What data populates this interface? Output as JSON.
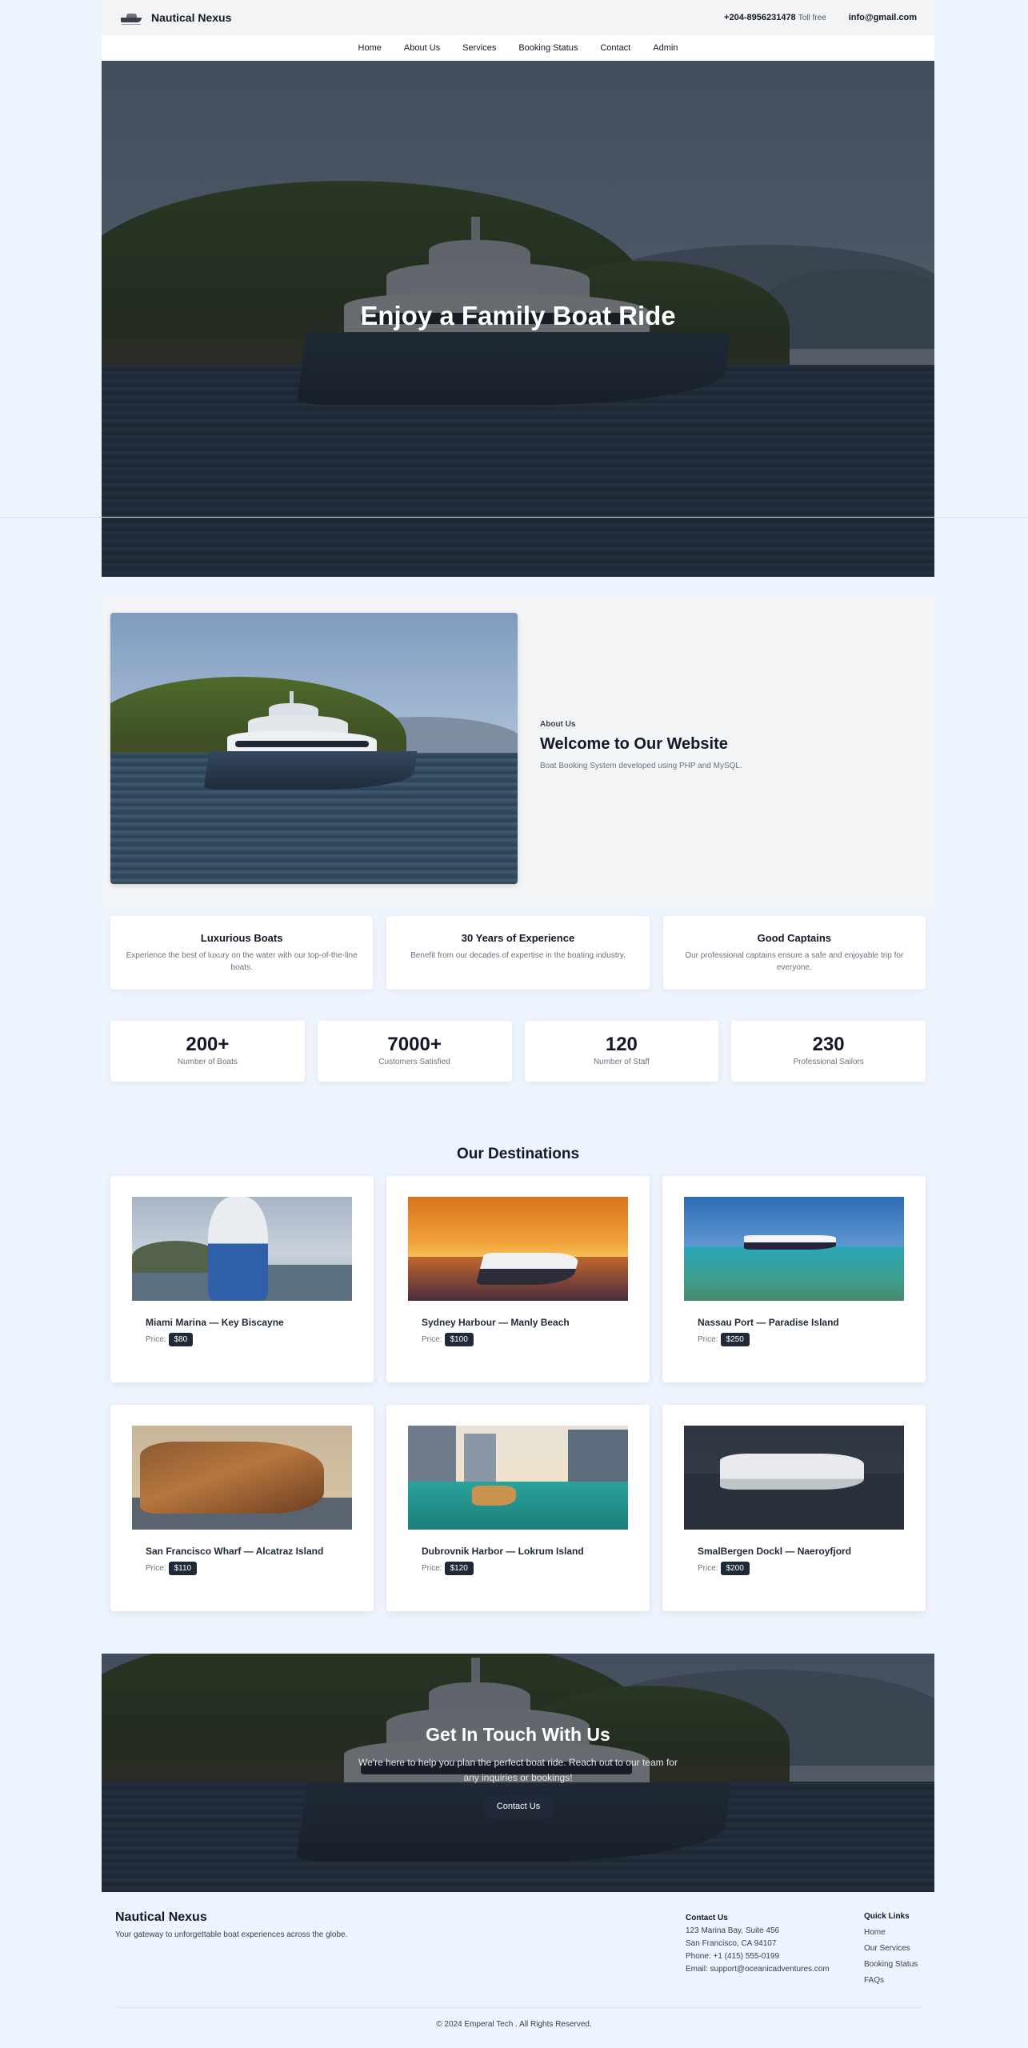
{
  "site": {
    "brand": "Nautical Nexus",
    "phone": "+204-8956231478",
    "phone_note": "Toll free",
    "email": "info@gmail.com"
  },
  "nav": {
    "items": [
      {
        "label": "Home"
      },
      {
        "label": "About Us"
      },
      {
        "label": "Services"
      },
      {
        "label": "Booking Status"
      },
      {
        "label": "Contact"
      },
      {
        "label": "Admin"
      }
    ]
  },
  "hero": {
    "title": "Enjoy a Family Boat Ride"
  },
  "about": {
    "kicker": "About Us",
    "title": "Welcome to Our Website",
    "description": "Boat Booking System developed using PHP and MySQL."
  },
  "features": [
    {
      "title": "Luxurious Boats",
      "desc": "Experience the best of luxury on the water with our top-of-the-line boats."
    },
    {
      "title": "30 Years of Experience",
      "desc": "Benefit from our decades of expertise in the boating industry."
    },
    {
      "title": "Good Captains",
      "desc": "Our professional captains ensure a safe and enjoyable trip for everyone."
    }
  ],
  "stats": [
    {
      "value": "200+",
      "label": "Number of Boats"
    },
    {
      "value": "7000+",
      "label": "Customers Satisfied"
    },
    {
      "value": "120",
      "label": "Number of Staff"
    },
    {
      "value": "230",
      "label": "Professional Sailors"
    }
  ],
  "destinations": {
    "title": "Our Destinations",
    "price_label": "Price:",
    "items": [
      {
        "name": "Miami Marina — Key Biscayne",
        "price": "$80"
      },
      {
        "name": "Sydney Harbour — Manly Beach",
        "price": "$100"
      },
      {
        "name": "Nassau Port — Paradise Island",
        "price": "$250"
      },
      {
        "name": "San Francisco Wharf — Alcatraz Island",
        "price": "$110"
      },
      {
        "name": "Dubrovnik Harbor — Lokrum Island",
        "price": "$120"
      },
      {
        "name": "SmalBergen Dockl — Naeroyfjord",
        "price": "$200"
      }
    ]
  },
  "cta": {
    "title": "Get In Touch With Us",
    "text": "We're here to help you plan the perfect boat ride. Reach out to our team for any inquiries or bookings!",
    "button": "Contact Us"
  },
  "footer": {
    "brand": "Nautical Nexus",
    "tagline": "Your gateway to unforgettable boat experiences across the globe.",
    "contact_heading": "Contact Us",
    "address1": "123 Marina Bay, Suite 456",
    "address2": "San Francisco, CA 94107",
    "phone": "Phone: +1 (415) 555-0199",
    "email": "Email: support@oceanicadventures.com",
    "links_heading": "Quick Links",
    "links": [
      {
        "label": "Home"
      },
      {
        "label": "Our Services"
      },
      {
        "label": "Booking Status"
      },
      {
        "label": "FAQs"
      }
    ],
    "copyright": "© 2024 Emperal Tech . All Rights Reserved."
  }
}
